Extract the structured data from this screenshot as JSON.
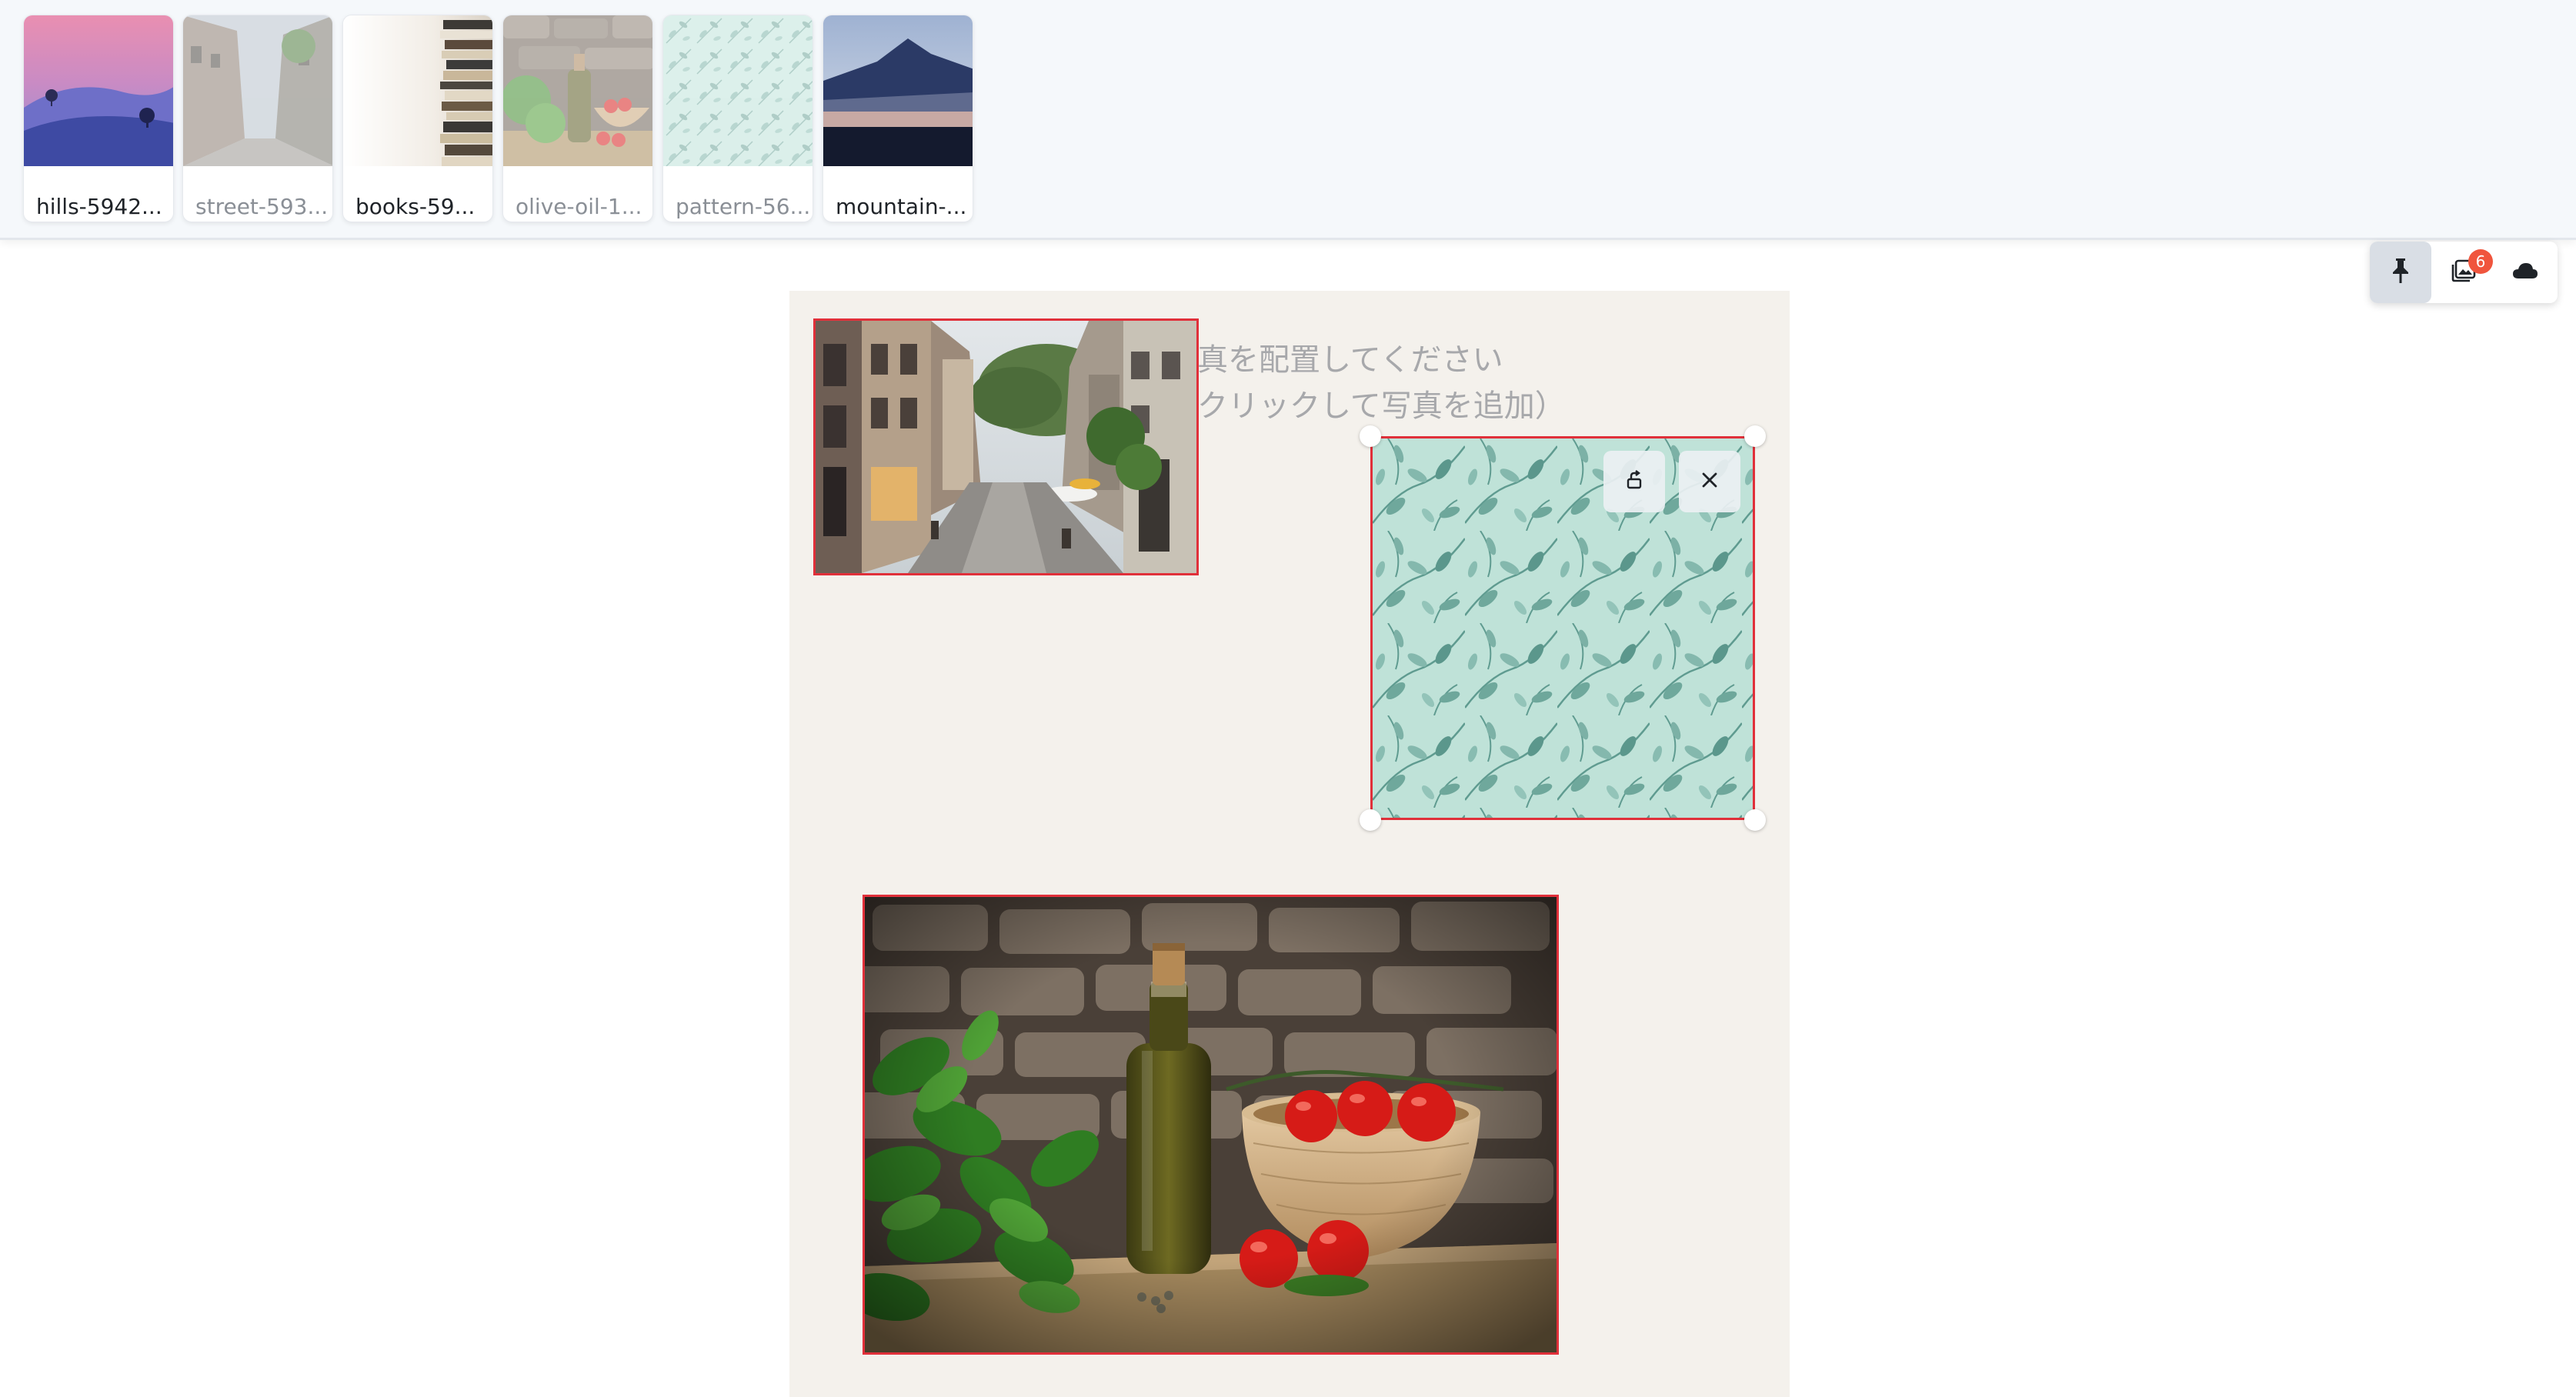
{
  "tray": {
    "thumbnails": [
      {
        "label": "hills-5942...",
        "used": false
      },
      {
        "label": "street-593...",
        "used": true
      },
      {
        "label": "books-59...",
        "used": false
      },
      {
        "label": "olive-oil-1...",
        "used": true
      },
      {
        "label": "pattern-56...",
        "used": true
      },
      {
        "label": "mountain-...",
        "used": false
      }
    ]
  },
  "toolbar": {
    "pin_icon": "pin-icon",
    "photos_icon": "image-stack-icon",
    "photos_badge": "6",
    "cloud_icon": "cloud-icon"
  },
  "canvas": {
    "placeholder_line1": "真を配置してください",
    "placeholder_line2": "クリックして写真を追加）",
    "selection_color": "#e0303a",
    "background": "#f4f1ec"
  }
}
